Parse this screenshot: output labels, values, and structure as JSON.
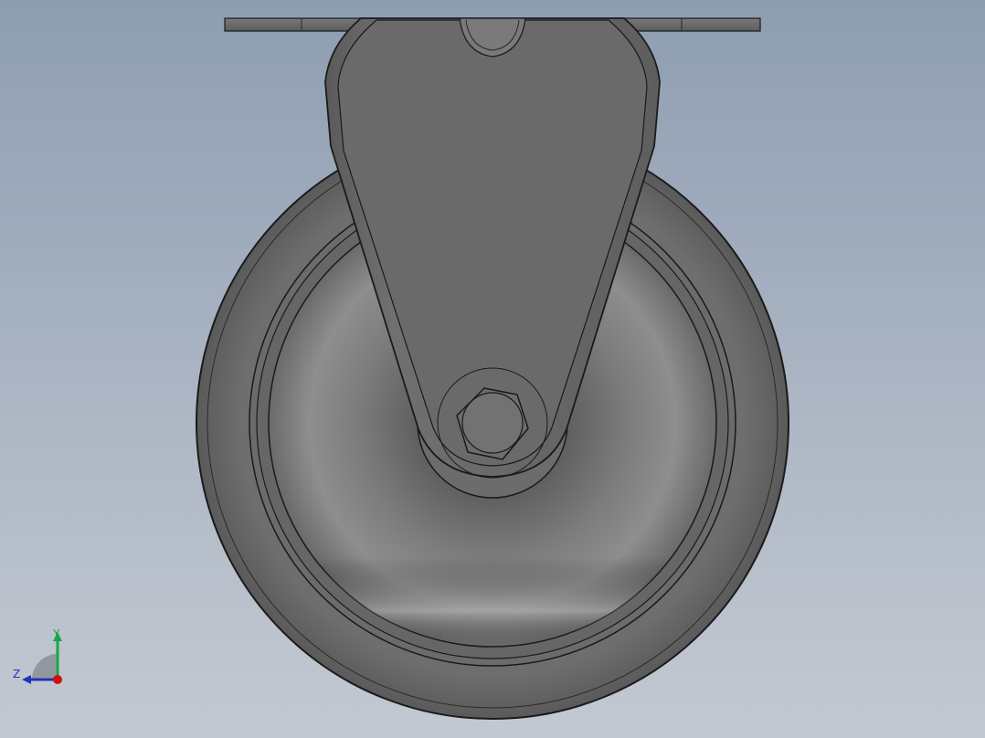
{
  "scene": {
    "colors": {
      "background_top": "#8e9db1",
      "background_bottom": "#c3c9d2",
      "part_gray": "#6c6c6c",
      "edge": "#1a1a1a"
    },
    "model": {
      "description_icon": "caster-wheel-model"
    }
  },
  "triad": {
    "y_label": "Y",
    "z_label": "Z",
    "colors": {
      "y": "#1da44a",
      "z": "#2233b8",
      "x": "#d01010"
    }
  }
}
